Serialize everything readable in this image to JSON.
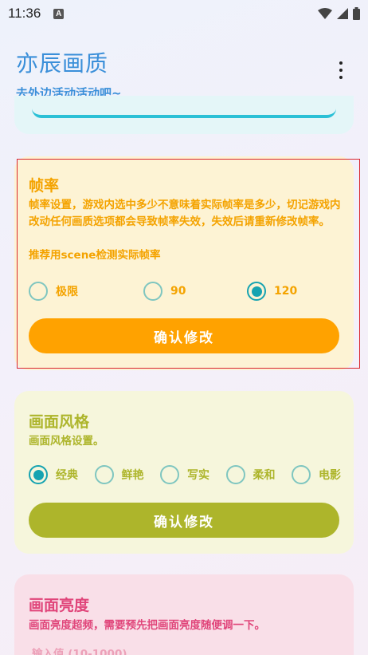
{
  "status": {
    "time": "11:36",
    "a_icon": "A"
  },
  "app": {
    "title": "亦辰画质",
    "subtitle": "去外边活动活动吧~"
  },
  "colors": {
    "fps_accent": "#f4a300",
    "fps_button": "#ffa200",
    "style_accent": "#adb52b",
    "style_button": "#adb52b",
    "bright_accent": "#e0457a",
    "radio_on": "#16a3b1"
  },
  "fps": {
    "title": "帧率",
    "desc": "帧率设置，游戏内选中多少不意味着实际帧率是多少，切记游戏内改动任何画质选项都会导致帧率失效，失效后请重新修改帧率。",
    "tip": "推荐用scene检测实际帧率",
    "options": [
      {
        "label": "极限",
        "selected": false
      },
      {
        "label": "90",
        "selected": false
      },
      {
        "label": "120",
        "selected": true
      }
    ],
    "button": "确认修改"
  },
  "style": {
    "title": "画面风格",
    "desc": "画面风格设置。",
    "options": [
      {
        "label": "经典",
        "selected": true
      },
      {
        "label": "鲜艳",
        "selected": false
      },
      {
        "label": "写实",
        "selected": false
      },
      {
        "label": "柔和",
        "selected": false
      },
      {
        "label": "电影",
        "selected": false
      }
    ],
    "button": "确认修改"
  },
  "brightness": {
    "title": "画面亮度",
    "desc": "画面亮度超频，需要预先把画面亮度随便调一下。",
    "input_placeholder": "输入值 (10-1000)"
  }
}
